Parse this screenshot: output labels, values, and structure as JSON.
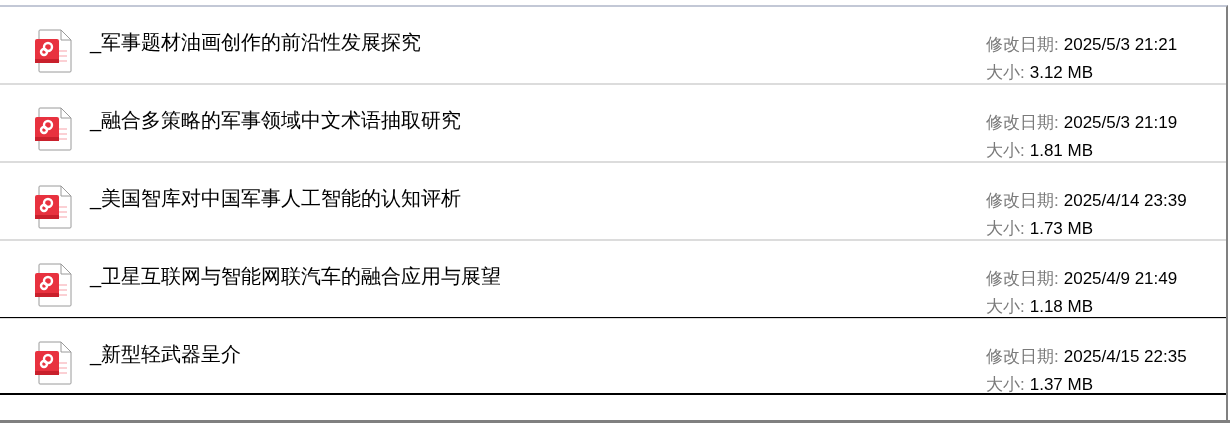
{
  "files": [
    {
      "name": "_军事题材油画创作的前沿性发展探究",
      "modified_label": "修改日期:",
      "modified": "2025/5/3 21:21",
      "size_label": "大小:",
      "size": "3.12 MB",
      "selected": false
    },
    {
      "name": "_融合多策略的军事领域中文术语抽取研究",
      "modified_label": "修改日期:",
      "modified": "2025/5/3 21:19",
      "size_label": "大小:",
      "size": "1.81 MB",
      "selected": false
    },
    {
      "name": "_美国智库对中国军事人工智能的认知评析",
      "modified_label": "修改日期:",
      "modified": "2025/4/14 23:39",
      "size_label": "大小:",
      "size": "1.73 MB",
      "selected": false
    },
    {
      "name": "_卫星互联网与智能网联汽车的融合应用与展望",
      "modified_label": "修改日期:",
      "modified": "2025/4/9 21:49",
      "size_label": "大小:",
      "size": "1.18 MB",
      "selected": false
    },
    {
      "name": "_新型轻武器呈介",
      "modified_label": "修改日期:",
      "modified": "2025/4/15 22:35",
      "size_label": "大小:",
      "size": "1.37 MB",
      "selected": true
    }
  ]
}
